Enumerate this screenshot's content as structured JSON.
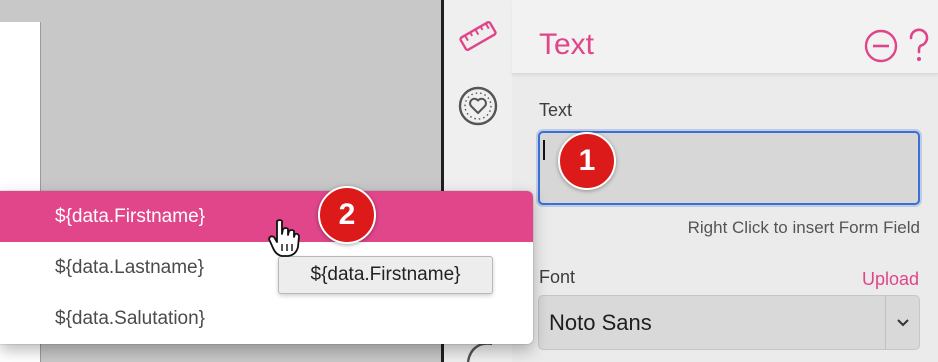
{
  "panel": {
    "title": "Text",
    "header_icons": [
      "minus-circle-icon",
      "help-icon"
    ],
    "accent_color": "#e0458a"
  },
  "text_field": {
    "label": "Text",
    "value": "",
    "hint": "Right Click to insert Form Field"
  },
  "font_field": {
    "label": "Font",
    "upload_label": "Upload",
    "selected": "Noto Sans"
  },
  "sidebar_icons": [
    "ruler-icon",
    "heart-badge-icon",
    "curve-icon"
  ],
  "context_menu": {
    "items": [
      "${data.Firstname}",
      "${data.Lastname}",
      "${data.Salutation}"
    ],
    "highlighted_index": 0,
    "highlight_color": "#e1468b"
  },
  "tooltip": {
    "text": "${data.Firstname}"
  },
  "steps": {
    "one": "1",
    "two": "2",
    "color": "#dd1a1a"
  }
}
